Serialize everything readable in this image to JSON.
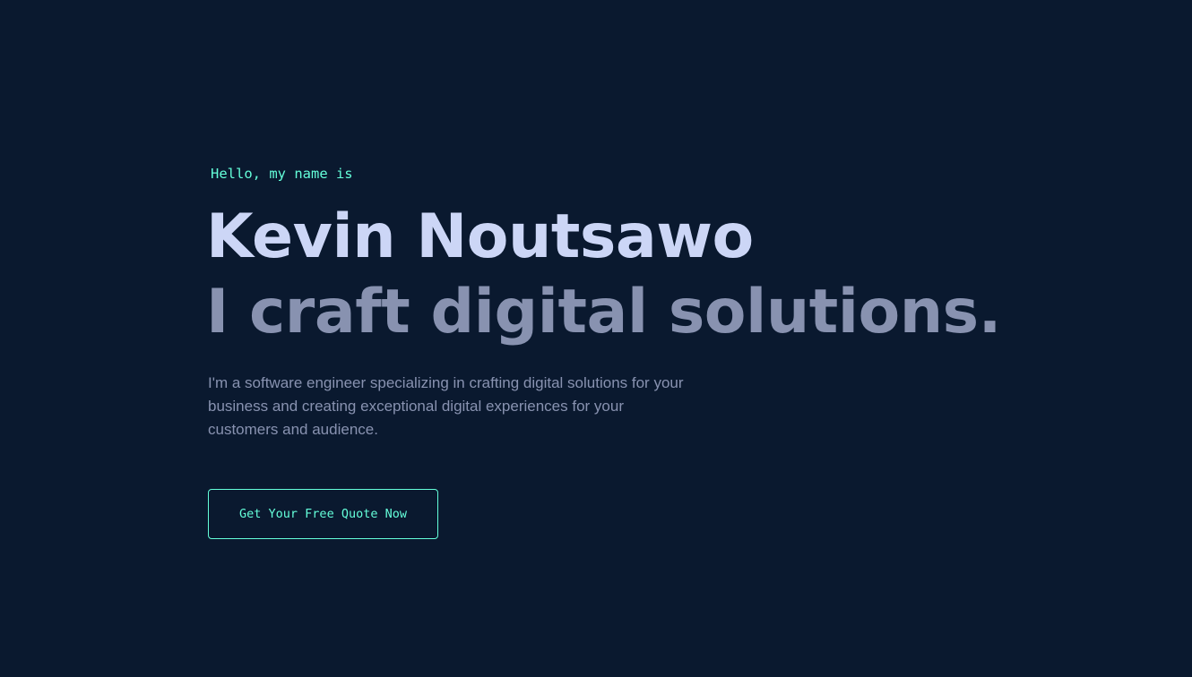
{
  "hero": {
    "intro": "Hello, my name is",
    "name": "Kevin Noutsawo",
    "tagline": "I craft digital solutions.",
    "description": "I'm a software engineer specializing in crafting digital solutions for your business and creating exceptional digital experiences for your customers and audience.",
    "cta_label": "Get Your Free Quote Now"
  },
  "colors": {
    "background": "#0a192f",
    "accent": "#64ffda",
    "heading": "#ccd6f6",
    "muted": "#8892b0"
  }
}
